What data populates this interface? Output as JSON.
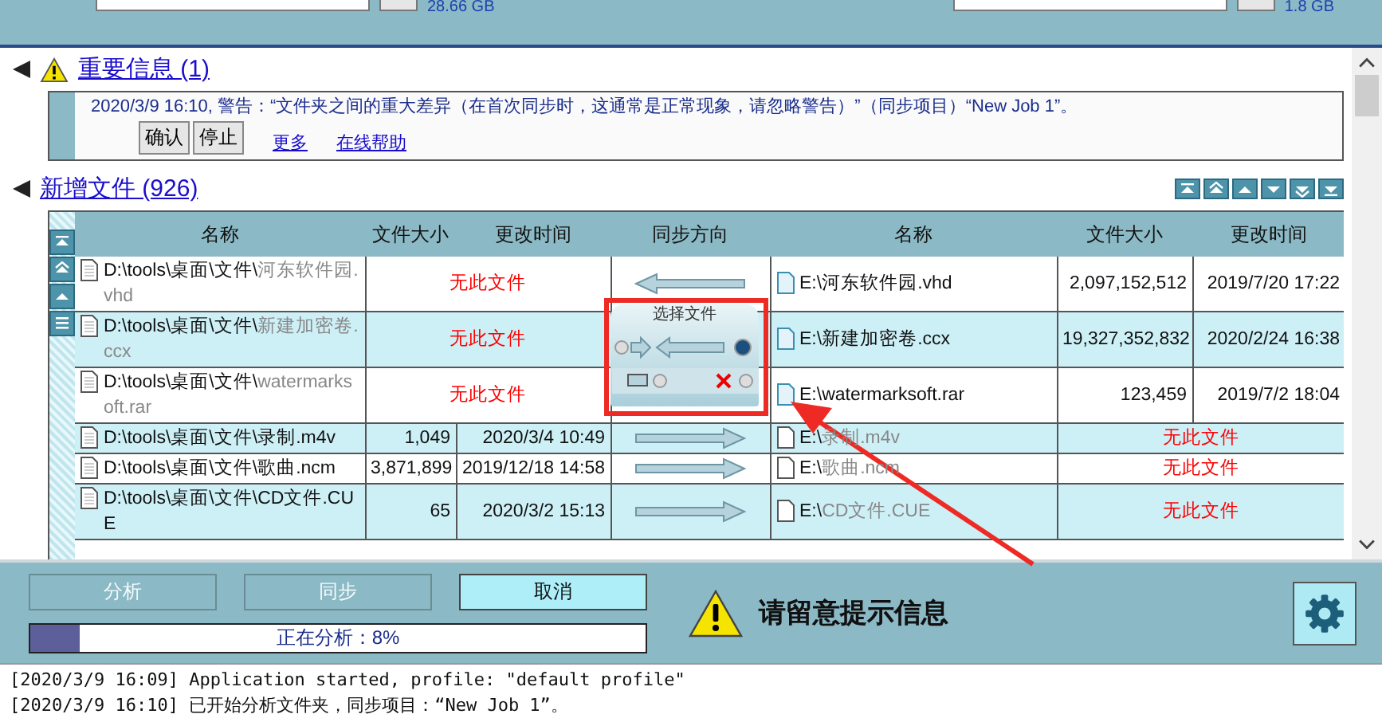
{
  "drive_bar": {
    "left_free": "28.66 GB",
    "right_free": "1.8 GB"
  },
  "messages": {
    "title": "重要信息",
    "count": "(1)",
    "expanded": true,
    "items": [
      {
        "text": "2020/3/9 16:10, 警告：“文件夹之间的重大差异（在首次同步时，这通常是正常现象，请忽略警告）”（同步项目）“New Job 1”。",
        "buttons": [
          "确认",
          "停止"
        ],
        "links": [
          "更多",
          "在线帮助"
        ]
      }
    ]
  },
  "new_files": {
    "title": "新增文件",
    "count": "(926)",
    "expanded": true,
    "columns_left": [
      "名称",
      "文件大小",
      "更改时间"
    ],
    "sync_column": "同步方向",
    "columns_right": [
      "名称",
      "文件大小",
      "更改时间"
    ],
    "rows": [
      {
        "kind": "rightonly",
        "missing_label": "无此文件",
        "left": {
          "dir": "D:\\tools\\桌面\\文件\\",
          "file": "河东软件园.vhd"
        },
        "right": {
          "dir": "E:\\",
          "file": "河东软件园.vhd",
          "size": "2,097,152,512",
          "time": "2019/7/20 17:22"
        }
      },
      {
        "kind": "rightonly",
        "missing_label": "无此文件",
        "left": {
          "dir": "D:\\tools\\桌面\\文件\\",
          "file": "新建加密卷.ccx"
        },
        "right": {
          "dir": "E:\\",
          "file": "新建加密卷.ccx",
          "size": "19,327,352,832",
          "time": "2020/2/24 16:38"
        }
      },
      {
        "kind": "rightonly",
        "missing_label": "无此文件",
        "left": {
          "dir": "D:\\tools\\桌面\\文件\\",
          "file": "watermarksoft.rar"
        },
        "right": {
          "dir": "E:\\",
          "file": "watermarksoft.rar",
          "size": "123,459",
          "time": "2019/7/2 18:04"
        }
      },
      {
        "kind": "leftonly",
        "missing_label": "无此文件",
        "left": {
          "dir": "D:\\tools\\桌面\\文件\\",
          "file": "录制.m4v",
          "size": "1,049",
          "time": "2020/3/4 10:49"
        },
        "right": {
          "dir": "E:\\",
          "file": "录制.m4v"
        }
      },
      {
        "kind": "leftonly",
        "missing_label": "无此文件",
        "left": {
          "dir": "D:\\tools\\桌面\\文件\\",
          "file": "歌曲.ncm",
          "size": "3,871,899",
          "time": "2019/12/18 14:58"
        },
        "right": {
          "dir": "E:\\",
          "file": "歌曲.ncm"
        }
      },
      {
        "kind": "leftonly",
        "missing_label": "无此文件",
        "left": {
          "dir": "D:\\tools\\桌面\\文件\\",
          "file": "CD文件.CUE",
          "size": "65",
          "time": "2020/3/2 15:13"
        },
        "right": {
          "dir": "E:\\",
          "file": "CD文件.CUE"
        }
      }
    ],
    "popup": {
      "title": "选择文件"
    }
  },
  "bottom": {
    "buttons": [
      {
        "label": "分析",
        "disabled": true
      },
      {
        "label": "同步",
        "disabled": true
      },
      {
        "label": "取消",
        "disabled": false
      }
    ],
    "progress": {
      "level": 0.08,
      "text": "正在分析：8%"
    },
    "notice": "请留意提示信息"
  },
  "log": [
    "[2020/3/9 16:09] Application started, profile: \"default profile\"",
    "[2020/3/9 16:10] 已开始分析文件夹，同步项目：“New Job 1”。"
  ]
}
